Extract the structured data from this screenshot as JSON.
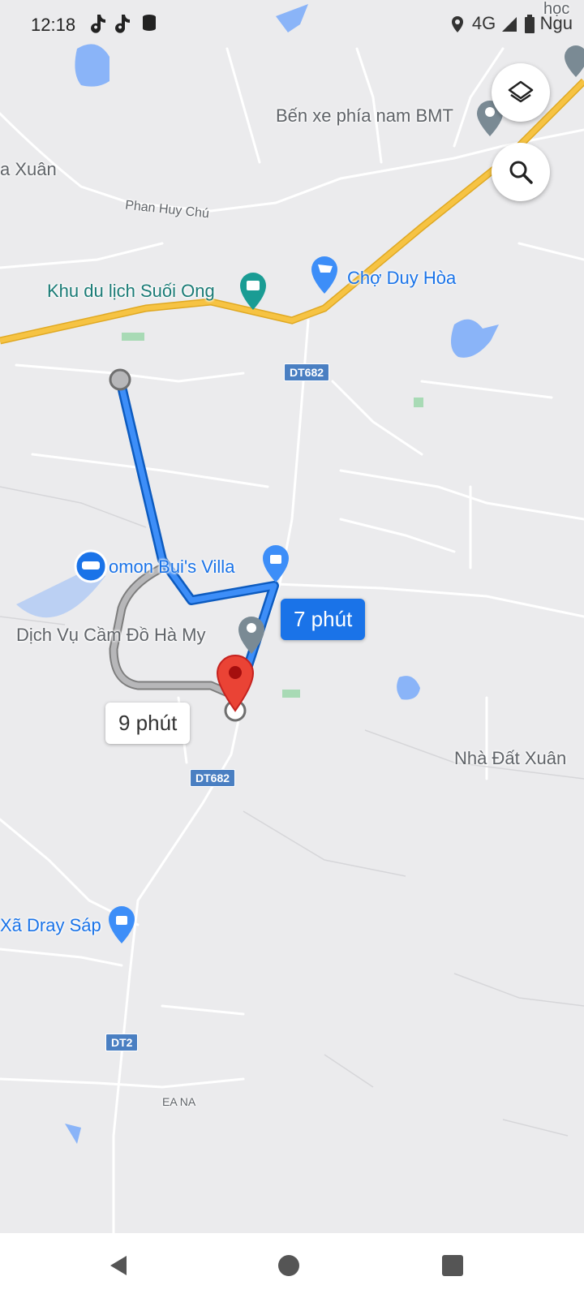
{
  "status_bar": {
    "time": "12:18",
    "left_icons": [
      "tiktok-icon",
      "tiktok-icon",
      "data-saver-icon"
    ],
    "network": "4G",
    "right_icons": [
      "location-icon",
      "signal-icon",
      "battery-icon"
    ],
    "edge_text": "Ngu"
  },
  "map": {
    "labels": {
      "ben_xe": "Bến xe phía nam BMT",
      "xuan": "a Xuân",
      "phan_huy_chu": "Phan Huy Chú",
      "khu_du_lich": "Khu du lịch Suối Ong",
      "cho_duy_hoa": "Chợ Duy Hòa",
      "homon": "omon Bui's Villa",
      "cam_do": "Dịch Vụ Cầm Đồ Hà My",
      "nha_dat": "Nhà Đất Xuân",
      "dray_sap": "Xã Dray Sáp",
      "ea_na": "EA NA",
      "hoc": "học"
    },
    "road_shields": [
      "DT682",
      "DT682",
      "DT2"
    ],
    "route": {
      "primary_eta": "7 phút",
      "alternate_eta": "9 phút"
    },
    "colors": {
      "primary_route": "#1a73e8",
      "alternate_route": "#9aa0a6",
      "highway": "#f6c343",
      "water": "#8ab4f8",
      "destination_pin": "#ea4335"
    }
  },
  "buttons": {
    "layers": "layers-icon",
    "search": "search-icon"
  },
  "nav_bar": {
    "back": "back-icon",
    "home": "home-icon",
    "recents": "recents-icon"
  }
}
